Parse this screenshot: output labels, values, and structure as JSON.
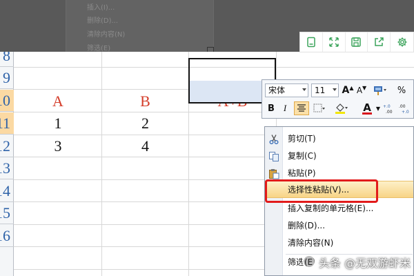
{
  "background_menu": {
    "items": [
      "插入(I)...",
      "删除(D)...",
      "清除内容(N)",
      "筛选(E)"
    ]
  },
  "float_toolbar": {
    "icons": [
      "bookmark-icon",
      "fullscreen-icon",
      "save-icon",
      "share-icon",
      "settings-icon"
    ],
    "accent": "#3aa35a"
  },
  "sheet": {
    "row_numbers": [
      "8",
      "9",
      "10",
      "11",
      "12",
      "13",
      "14",
      "15",
      "16"
    ],
    "headers": {
      "a": "A",
      "b": "B",
      "sum": "A+B"
    },
    "rows": [
      {
        "a": "1",
        "b": "2"
      },
      {
        "a": "3",
        "b": "4"
      }
    ],
    "header_color": "#d43d2a",
    "row_number_color": "#2e62a8"
  },
  "mini_toolbar": {
    "font_name": "宋体",
    "font_size": "11",
    "grow_font": "A",
    "shrink_font": "A",
    "percent": "%",
    "bold": "B",
    "italic": "I",
    "font_color_letter": "A",
    "inc_decimal": "+.0 .00",
    "dec_decimal": ".00 +.0"
  },
  "context_menu": {
    "items": [
      {
        "label": "剪切(T)",
        "icon": "scissors-icon"
      },
      {
        "label": "复制(C)",
        "icon": "copy-icon"
      },
      {
        "label": "粘贴(P)",
        "icon": "paste-icon"
      },
      {
        "label": "选择性粘贴(V)...",
        "icon": "",
        "highlighted": true
      },
      {
        "label": "插入复制的单元格(E)...",
        "icon": ""
      },
      {
        "label": "删除(D)...",
        "icon": ""
      },
      {
        "label": "清除内容(N)",
        "icon": ""
      },
      {
        "label": "筛选(E)",
        "icon": ""
      }
    ],
    "highlight_color": "#e21b1b"
  },
  "watermark": {
    "text": "头条 @无双游虾米"
  }
}
